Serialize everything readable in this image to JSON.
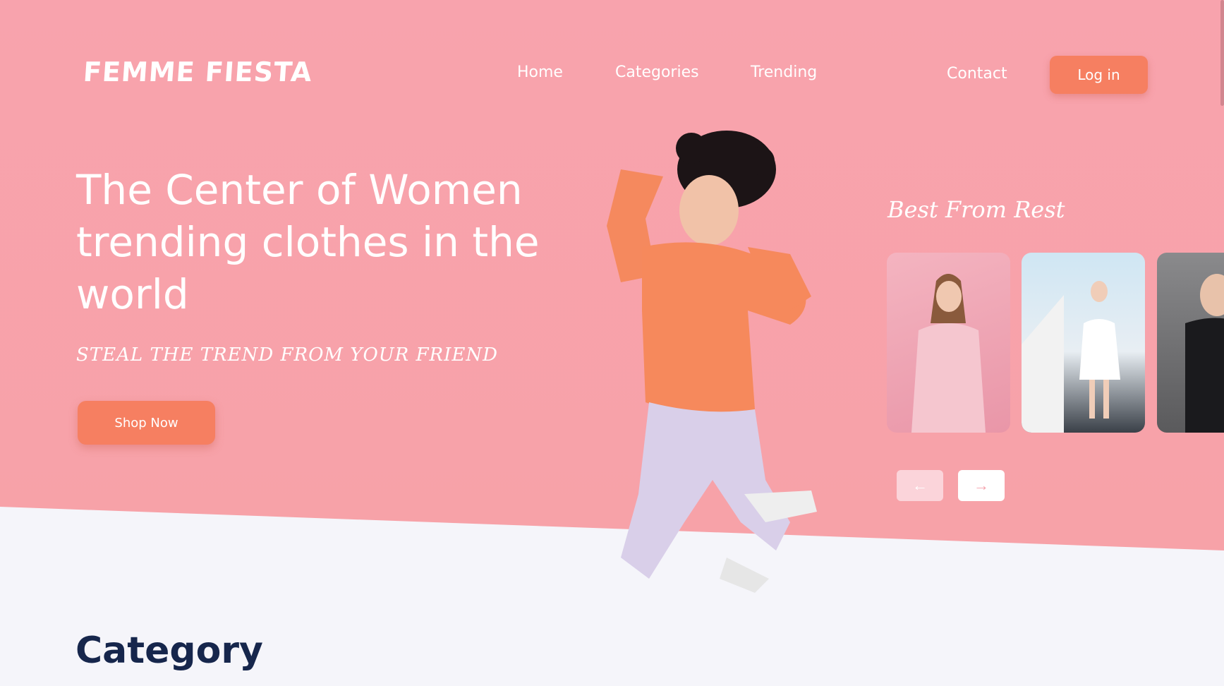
{
  "brand": {
    "logo": "FEMME FIESTA"
  },
  "nav": {
    "home": "Home",
    "categories": "Categories",
    "trending": "Trending",
    "contact": "Contact",
    "login": "Log in"
  },
  "hero": {
    "headline": "The Center of Women trending clothes in the world",
    "tagline": "STEAL THE TREND FROM YOUR FRIEND",
    "cta": "Shop Now"
  },
  "carousel": {
    "title": "Best From Rest",
    "prev_icon": "arrow-left-icon",
    "next_icon": "arrow-right-icon"
  },
  "sections": {
    "category_title": "Category"
  },
  "colors": {
    "hero_bg": "#f8a3ad",
    "accent": "#f67f61",
    "heading_dark": "#16264c",
    "page_bg": "#f5f5fa"
  }
}
